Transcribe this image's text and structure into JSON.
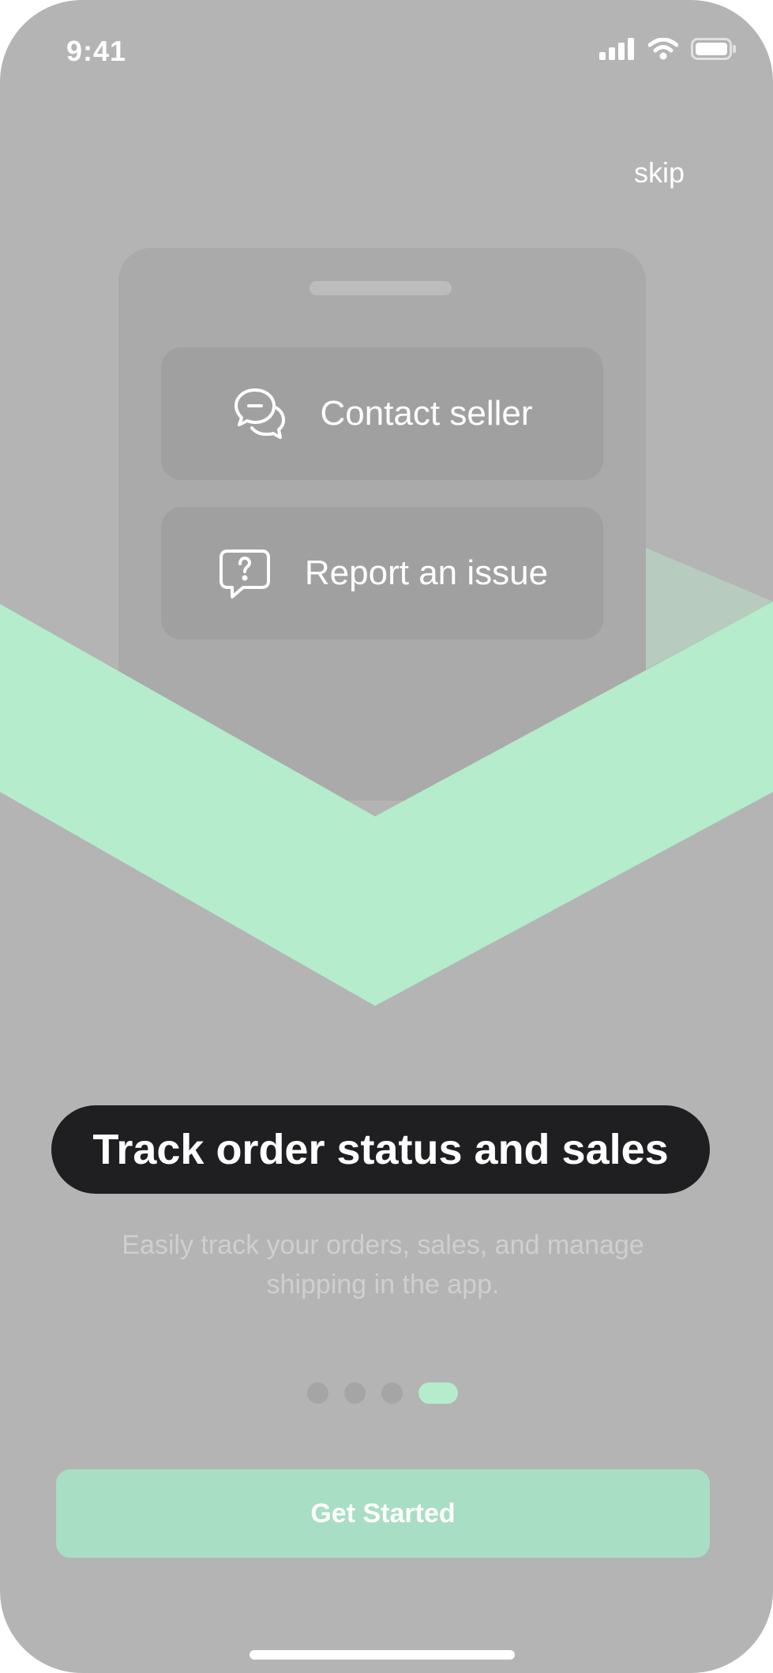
{
  "status_bar": {
    "time": "9:41",
    "icons": [
      "cellular-signal-icon",
      "wifi-icon",
      "battery-icon"
    ]
  },
  "header": {
    "skip_label": "skip"
  },
  "illustration": {
    "cards": [
      {
        "label": "Contact seller",
        "icon": "chat-bubbles-icon"
      },
      {
        "label": "Report an issue",
        "icon": "question-bubble-icon"
      }
    ]
  },
  "content": {
    "title": "Track order status and sales",
    "subtitle_line1": "Easily track your orders, sales, and manage",
    "subtitle_line2": "shipping in the app."
  },
  "pagination": {
    "total": 4,
    "active_index": 3
  },
  "cta": {
    "label": "Get Started"
  },
  "colors": {
    "background": "#b4b4b4",
    "accent": "#b4eccc",
    "title_pill": "#1f1f21",
    "button": "#a8dec4"
  }
}
